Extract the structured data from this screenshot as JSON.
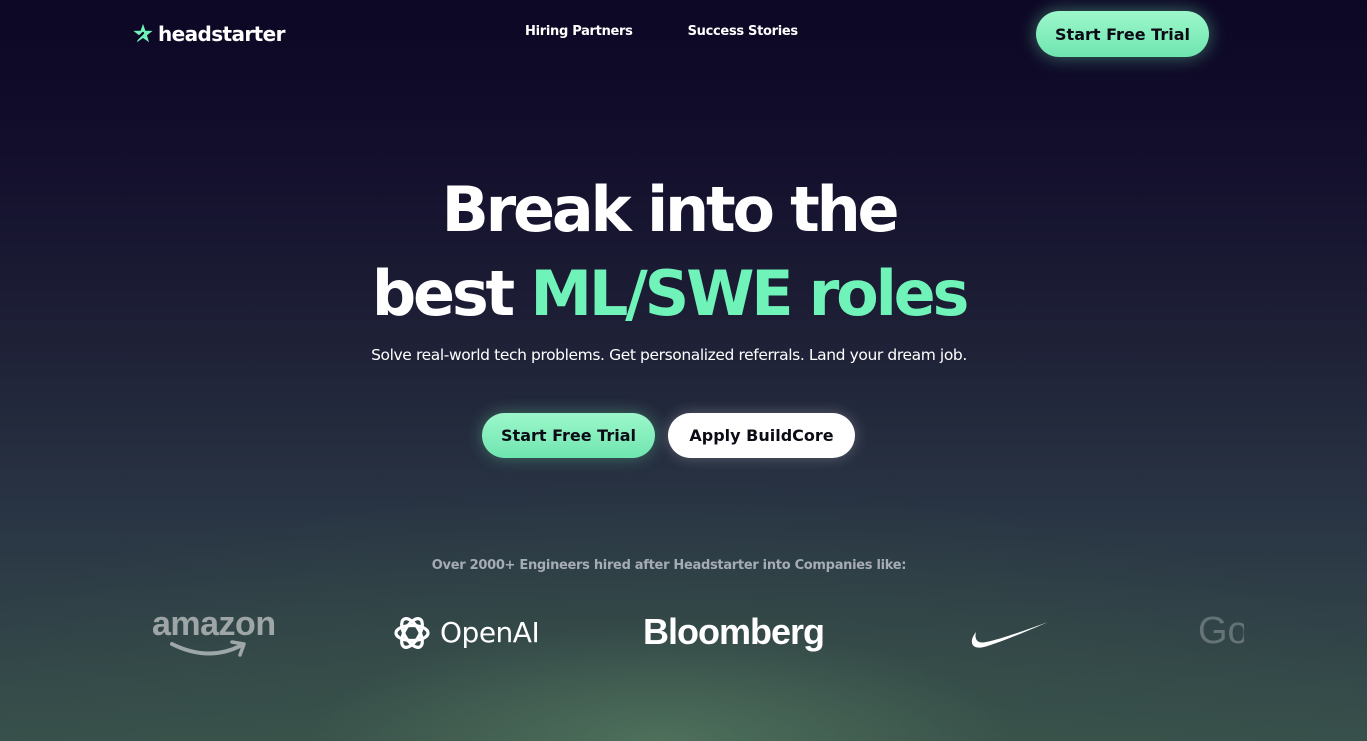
{
  "brand": {
    "name": "headstarter",
    "logo_icon": "star-arrow-icon",
    "accent_color": "#6ff3b8"
  },
  "nav": {
    "links": [
      "Hiring Partners",
      "Success Stories"
    ],
    "cta_label": "Start Free Trial"
  },
  "hero": {
    "title_line1": "Break into the",
    "title_line2_plain": "best ",
    "title_line2_accent": "ML/SWE roles",
    "subtitle": "Solve real-world tech problems. Get personalized referrals. Land your dream job.",
    "primary_cta": "Start Free Trial",
    "secondary_cta": "Apply BuildCore"
  },
  "companies": {
    "caption": "Over 2000+ Engineers hired after Headstarter into Companies like:",
    "logos": [
      {
        "name": "amazon",
        "text": "amazon"
      },
      {
        "name": "openai",
        "text": "OpenAI"
      },
      {
        "name": "bloomberg",
        "text": "Bloomberg"
      },
      {
        "name": "nike",
        "text": ""
      },
      {
        "name": "google",
        "text": "Go"
      }
    ]
  }
}
